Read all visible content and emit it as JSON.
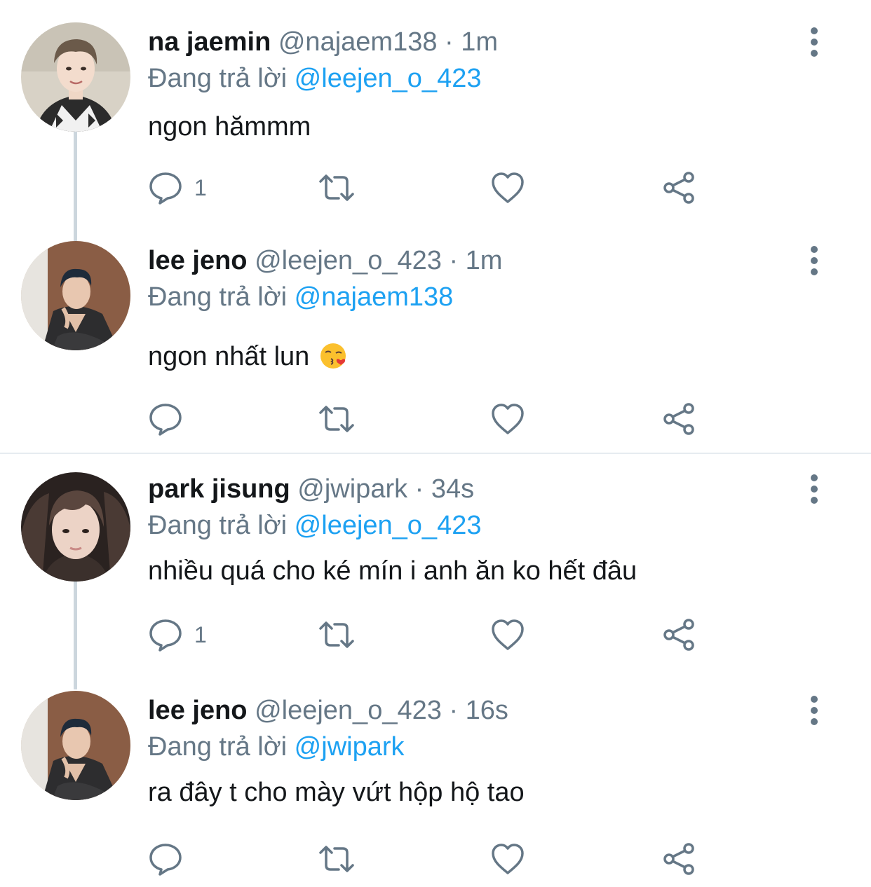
{
  "colors": {
    "text": "#14171a",
    "secondary": "#657786",
    "link": "#1da1f2",
    "thread_line": "#ccd6dd",
    "divider": "#e6ecf0"
  },
  "reply_prefix": "Đang trả lời",
  "tweets": [
    {
      "display_name": "na jaemin",
      "handle": "@najaem138",
      "separator": "·",
      "time": "1m",
      "reply_to": "@leejen_o_423",
      "text": "ngon hămmm",
      "reply_count": "1",
      "avatar_icon": "avatar-photo"
    },
    {
      "display_name": "lee jeno",
      "handle": "@leejen_o_423",
      "separator": "·",
      "time": "1m",
      "reply_to": "@najaem138",
      "text": "ngon nhất lun",
      "emoji_icon": "kissing-face-emoji",
      "reply_count": "",
      "avatar_icon": "avatar-photo"
    },
    {
      "display_name": "park jisung",
      "handle": "@jwipark",
      "separator": "·",
      "time": "34s",
      "reply_to": "@leejen_o_423",
      "text": "nhiều quá cho ké mín i anh ăn ko hết đâu",
      "reply_count": "1",
      "avatar_icon": "avatar-photo"
    },
    {
      "display_name": "lee jeno",
      "handle": "@leejen_o_423",
      "separator": "·",
      "time": "16s",
      "reply_to": "@jwipark",
      "text": "ra đây t cho mày vứt hộp hộ tao",
      "reply_count": "",
      "avatar_icon": "avatar-photo"
    }
  ]
}
